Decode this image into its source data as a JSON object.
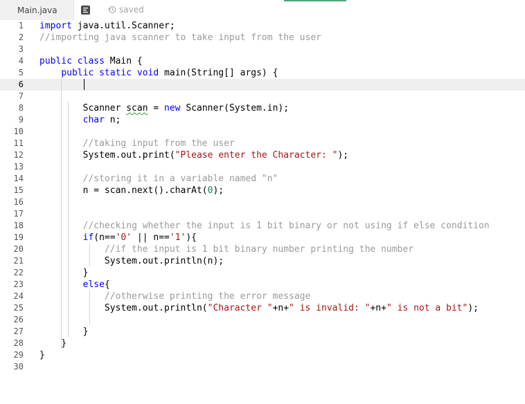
{
  "tab": {
    "filename": "Main.java",
    "status": "saved"
  },
  "icons": {
    "format": "format-code-icon",
    "saved": "history-icon"
  },
  "colors": {
    "keyword": "#0000ff",
    "comment": "#9a9a9a",
    "string": "#a31515",
    "number": "#098658",
    "accent": "#4aa872"
  },
  "editor": {
    "active_line": 6,
    "lines": [
      {
        "n": "1",
        "tokens": [
          [
            "k",
            "import"
          ],
          [
            "p",
            " java.util.Scanner;"
          ]
        ]
      },
      {
        "n": "2",
        "tokens": [
          [
            "c",
            "//importing java scanner to take input from the user"
          ]
        ]
      },
      {
        "n": "3",
        "tokens": []
      },
      {
        "n": "4",
        "tokens": [
          [
            "k",
            "public"
          ],
          [
            "p",
            " "
          ],
          [
            "k",
            "class"
          ],
          [
            "p",
            " Main {"
          ]
        ]
      },
      {
        "n": "5",
        "tokens": [
          [
            "p",
            "    "
          ],
          [
            "k",
            "public"
          ],
          [
            "p",
            " "
          ],
          [
            "k",
            "static"
          ],
          [
            "p",
            " "
          ],
          [
            "k",
            "void"
          ],
          [
            "p",
            " main(String[] args) {"
          ]
        ]
      },
      {
        "n": "6",
        "tokens": []
      },
      {
        "n": "7",
        "tokens": []
      },
      {
        "n": "8",
        "tokens": [
          [
            "p",
            "        Scanner "
          ],
          [
            "w",
            "scan"
          ],
          [
            "p",
            " = "
          ],
          [
            "k",
            "new"
          ],
          [
            "p",
            " Scanner(System.in);"
          ]
        ]
      },
      {
        "n": "9",
        "tokens": [
          [
            "p",
            "        "
          ],
          [
            "k",
            "char"
          ],
          [
            "p",
            " n;"
          ]
        ]
      },
      {
        "n": "10",
        "tokens": []
      },
      {
        "n": "11",
        "tokens": [
          [
            "p",
            "        "
          ],
          [
            "c",
            "//taking input from the user"
          ]
        ]
      },
      {
        "n": "12",
        "tokens": [
          [
            "p",
            "        System.out.print("
          ],
          [
            "s",
            "\"Please enter the Character: \""
          ],
          [
            "p",
            ");"
          ]
        ]
      },
      {
        "n": "13",
        "tokens": []
      },
      {
        "n": "14",
        "tokens": [
          [
            "p",
            "        "
          ],
          [
            "c",
            "//storing it in a variable named \"n\""
          ]
        ]
      },
      {
        "n": "15",
        "tokens": [
          [
            "p",
            "        n = scan.next().charAt("
          ],
          [
            "n",
            "0"
          ],
          [
            "p",
            ");"
          ]
        ]
      },
      {
        "n": "16",
        "tokens": []
      },
      {
        "n": "17",
        "tokens": []
      },
      {
        "n": "18",
        "tokens": [
          [
            "p",
            "        "
          ],
          [
            "c",
            "//checking whether the input is 1 bit binary or not using if else condition"
          ]
        ]
      },
      {
        "n": "19",
        "tokens": [
          [
            "p",
            "        "
          ],
          [
            "k",
            "if"
          ],
          [
            "p",
            "(n=="
          ],
          [
            "s",
            "'0'"
          ],
          [
            "p",
            " || n=="
          ],
          [
            "s",
            "'1'"
          ],
          [
            "p",
            "){"
          ]
        ]
      },
      {
        "n": "20",
        "tokens": [
          [
            "p",
            "            "
          ],
          [
            "c",
            "//if the input is 1 bit binary number printing the number"
          ]
        ]
      },
      {
        "n": "21",
        "tokens": [
          [
            "p",
            "            System.out.println(n);"
          ]
        ]
      },
      {
        "n": "22",
        "tokens": [
          [
            "p",
            "        }"
          ]
        ]
      },
      {
        "n": "23",
        "tokens": [
          [
            "p",
            "        "
          ],
          [
            "k",
            "else"
          ],
          [
            "p",
            "{"
          ]
        ]
      },
      {
        "n": "24",
        "tokens": [
          [
            "p",
            "            "
          ],
          [
            "c",
            "//otherwise printing the error message"
          ]
        ]
      },
      {
        "n": "25",
        "tokens": [
          [
            "p",
            "            System.out.println("
          ],
          [
            "s",
            "\"Character \""
          ],
          [
            "p",
            "+n+"
          ],
          [
            "s",
            "\" is invalid: \""
          ],
          [
            "p",
            "+n+"
          ],
          [
            "s",
            "\" is not a bit\""
          ],
          [
            "p",
            ");"
          ]
        ]
      },
      {
        "n": "26",
        "tokens": []
      },
      {
        "n": "27",
        "tokens": [
          [
            "p",
            "        }"
          ]
        ]
      },
      {
        "n": "28",
        "tokens": [
          [
            "p",
            "    }"
          ]
        ]
      },
      {
        "n": "29",
        "tokens": [
          [
            "p",
            "}"
          ]
        ]
      },
      {
        "n": "30",
        "tokens": []
      }
    ]
  }
}
